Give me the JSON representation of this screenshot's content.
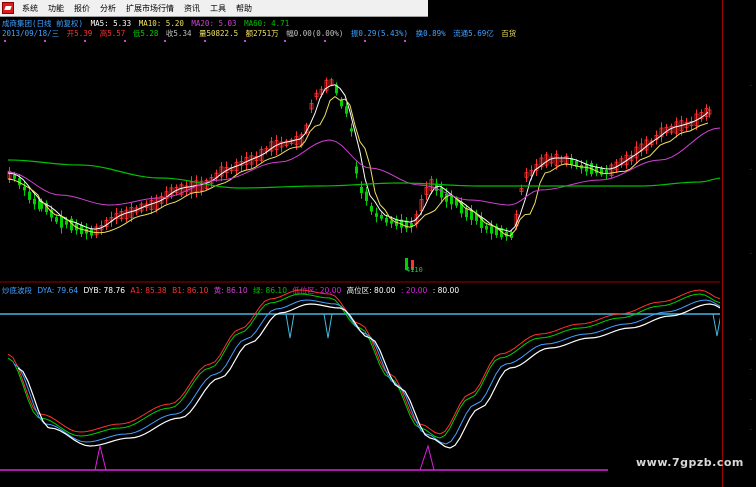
{
  "menu": {
    "items": [
      "系统",
      "功能",
      "报价",
      "分析",
      "扩展市场行情",
      "资讯",
      "工具",
      "帮助"
    ]
  },
  "info_row1": {
    "title": "成商集团(日线 前复权)",
    "ma5": "MA5: 5.33",
    "ma10": "MA10: 5.20",
    "ma20": "MA20: 5.03",
    "ma60": "MA60: 4.71"
  },
  "info_row2": {
    "date": "2013/09/18/三",
    "open": "开5.39",
    "high": "高5.57",
    "low": "低5.28",
    "close": "收5.34",
    "volume": "量50822.5",
    "amount": "额2751万",
    "change": "幅0.00(0.00%)",
    "range": "振0.29(5.43%)",
    "turnover": "换0.89%",
    "float": "流通5.69亿",
    "tag": "百货"
  },
  "indicator_row": {
    "name": "炒底波段",
    "dya": "DYA: 79.64",
    "dyb": "DYB: 78.76",
    "a1": "A1: 85.38",
    "b1": "B1: 86.10",
    "huang": "黄: 86.10",
    "lv": "绿: 86.10",
    "low_zone": "低位区: 20.00",
    "high_zone": "高位区: 80.00",
    "v20": ": 20.00",
    "v80": ": 80.00"
  },
  "volume_label": "4110",
  "watermark": "www.7gpzb.com",
  "colors": {
    "up": "#ff3030",
    "down": "#00d000",
    "ma5": "#ffffff",
    "ma10": "#f0e060",
    "ma20": "#d040d0",
    "ma60": "#00c000",
    "dya": "#40a0ff",
    "level": "#40b8e0",
    "magenta": "#e020e0"
  }
}
